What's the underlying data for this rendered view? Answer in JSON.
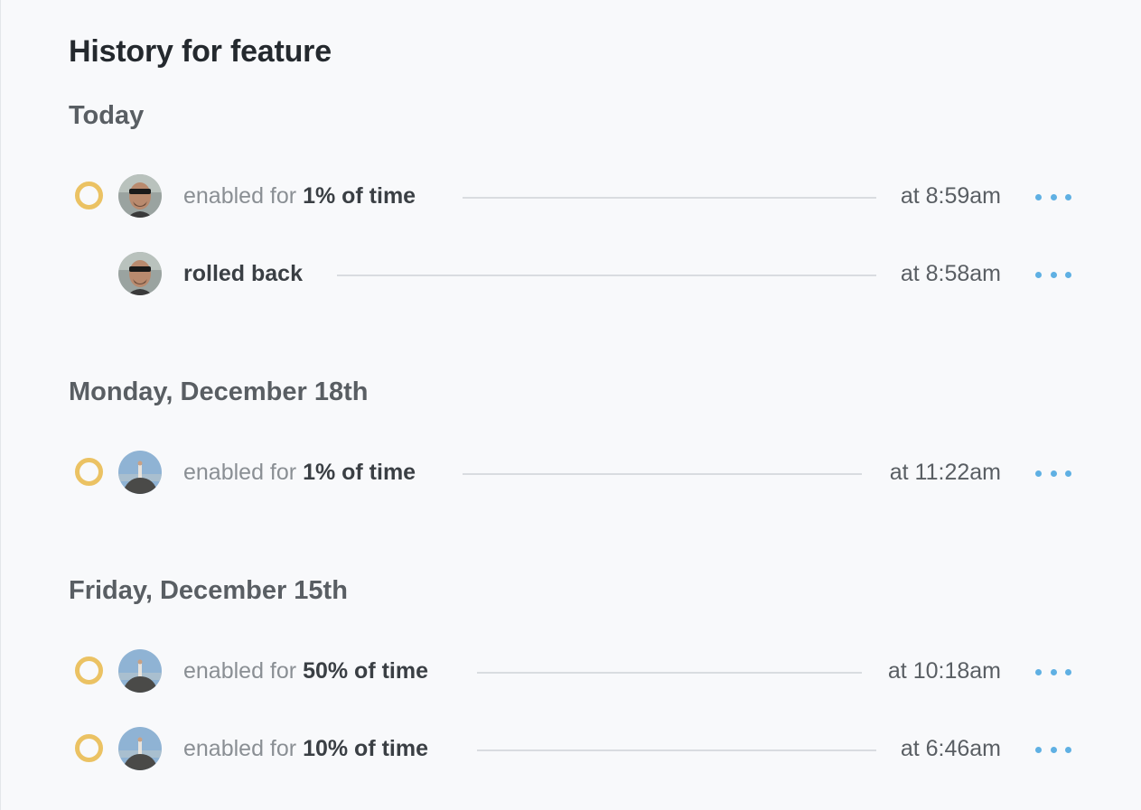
{
  "title": "History for feature",
  "sections": [
    {
      "heading": "Today",
      "entries": [
        {
          "prefix": "enabled for",
          "action": "1% of time",
          "time": "at 8:59am",
          "avatar": "man-sunglasses-avatar",
          "has_marker": true
        },
        {
          "prefix": "",
          "action": "rolled back",
          "time": "at 8:58am",
          "avatar": "man-sunglasses-avatar",
          "has_marker": false
        }
      ]
    },
    {
      "heading": "Monday, December 18th",
      "entries": [
        {
          "prefix": "enabled for",
          "action": "1% of time",
          "time": "at 11:22am",
          "avatar": "person-on-rock-avatar",
          "has_marker": true
        }
      ]
    },
    {
      "heading": "Friday, December 15th",
      "entries": [
        {
          "prefix": "enabled for",
          "action": "50% of time",
          "time": "at 10:18am",
          "avatar": "person-on-rock-avatar",
          "has_marker": true
        },
        {
          "prefix": "enabled for",
          "action": "10% of time",
          "time": "at 6:46am",
          "avatar": "person-on-rock-avatar",
          "has_marker": true
        }
      ]
    }
  ],
  "colors": {
    "marker": "#ebc263",
    "more_dots": "#5fb0e3"
  },
  "icons": {
    "marker": "ring-marker-icon",
    "more": "more-dots-icon"
  }
}
